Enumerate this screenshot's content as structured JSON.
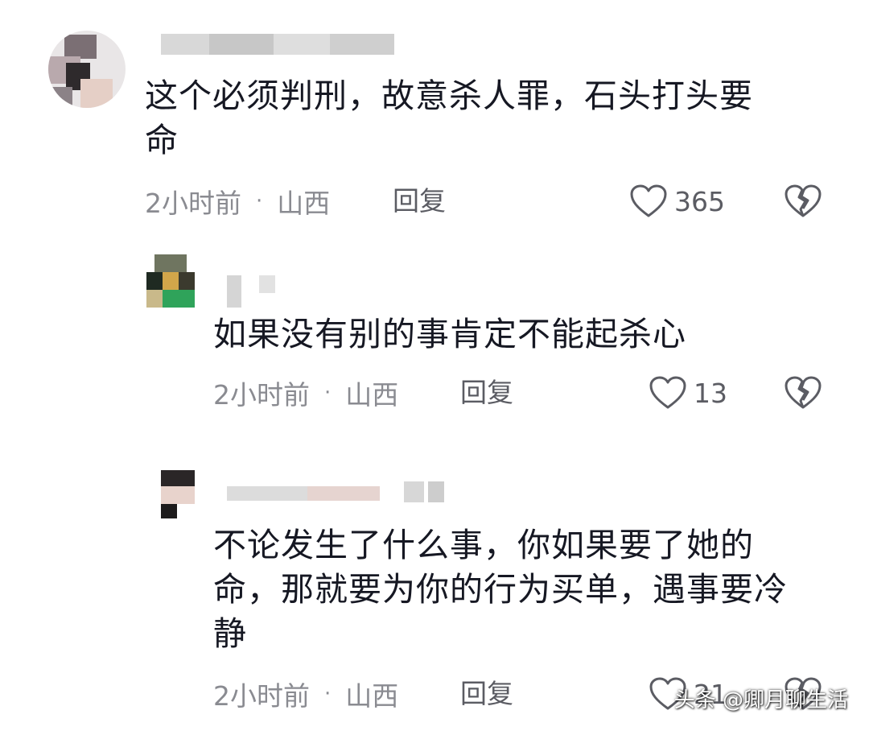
{
  "comments": [
    {
      "text": "这个必须判刑，故意杀人罪，石头打头要\n命",
      "time": "2小时前",
      "location": "山西",
      "reply_label": "回复",
      "likes": "365"
    },
    {
      "text": "如果没有别的事肯定不能起杀心",
      "time": "2小时前",
      "location": "山西",
      "reply_label": "回复",
      "likes": "13"
    },
    {
      "text": "不论发生了什么事，你如果要了她的\n命，那就要为你的行为买单，遇事要冷\n静",
      "time": "2小时前",
      "location": "山西",
      "reply_label": "回复",
      "likes": "21"
    }
  ],
  "separator": "·",
  "watermark": "头条 @卿月聊生活",
  "colors": {
    "text": "#161823",
    "meta": "#8a8b91",
    "icon": "#5b5c63"
  },
  "icons": {
    "like": "heart-outline-icon",
    "dislike": "broken-heart-icon"
  }
}
